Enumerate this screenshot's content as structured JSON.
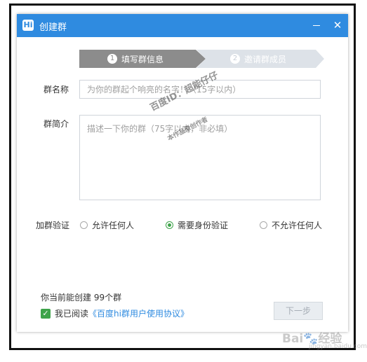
{
  "window": {
    "logo_text": "Hi",
    "title": "创建群",
    "minimize_icon": "minimize-icon",
    "close_icon": "close-icon",
    "close_glyph": "✕"
  },
  "steps": [
    {
      "number": "1",
      "label": "填写群信息",
      "active": true,
      "color": "#8c8c8c"
    },
    {
      "number": "2",
      "label": "邀请群成员",
      "active": false,
      "color": "#c6cdd6"
    }
  ],
  "form": {
    "name_label": "群名称",
    "name_placeholder": "为你的群起个响亮的名字！（15字以内）",
    "name_value": "",
    "intro_label": "群简介",
    "intro_placeholder": "描述一下你的群（75字以内，非必填）",
    "intro_value": "",
    "verify_label": "加群验证",
    "verify_options": [
      {
        "label": "允许任何人",
        "checked": false
      },
      {
        "label": "需要身份验证",
        "checked": true
      },
      {
        "label": "不允许任何人",
        "checked": false
      }
    ]
  },
  "footer": {
    "quota_text": "你当前能创建 99个群",
    "agree_prefix": "我已阅读",
    "agree_link": "《百度hi群用户使用协议》",
    "agree_checked": true,
    "check_glyph": "✓",
    "next_button": "下一步"
  },
  "watermarks": {
    "line1": "百度ID：超能仔仔",
    "line2": "本作品原创作者",
    "baidu_logo": "Bai🐾经验",
    "baidu_sub": "jingyan.baidu.com"
  },
  "colors": {
    "titlebar": "#2f8be0",
    "accent_green": "#3ea34a",
    "link_blue": "#2f8be0",
    "step_active": "#8c8c8c",
    "step_inactive": "#dde2e8"
  }
}
